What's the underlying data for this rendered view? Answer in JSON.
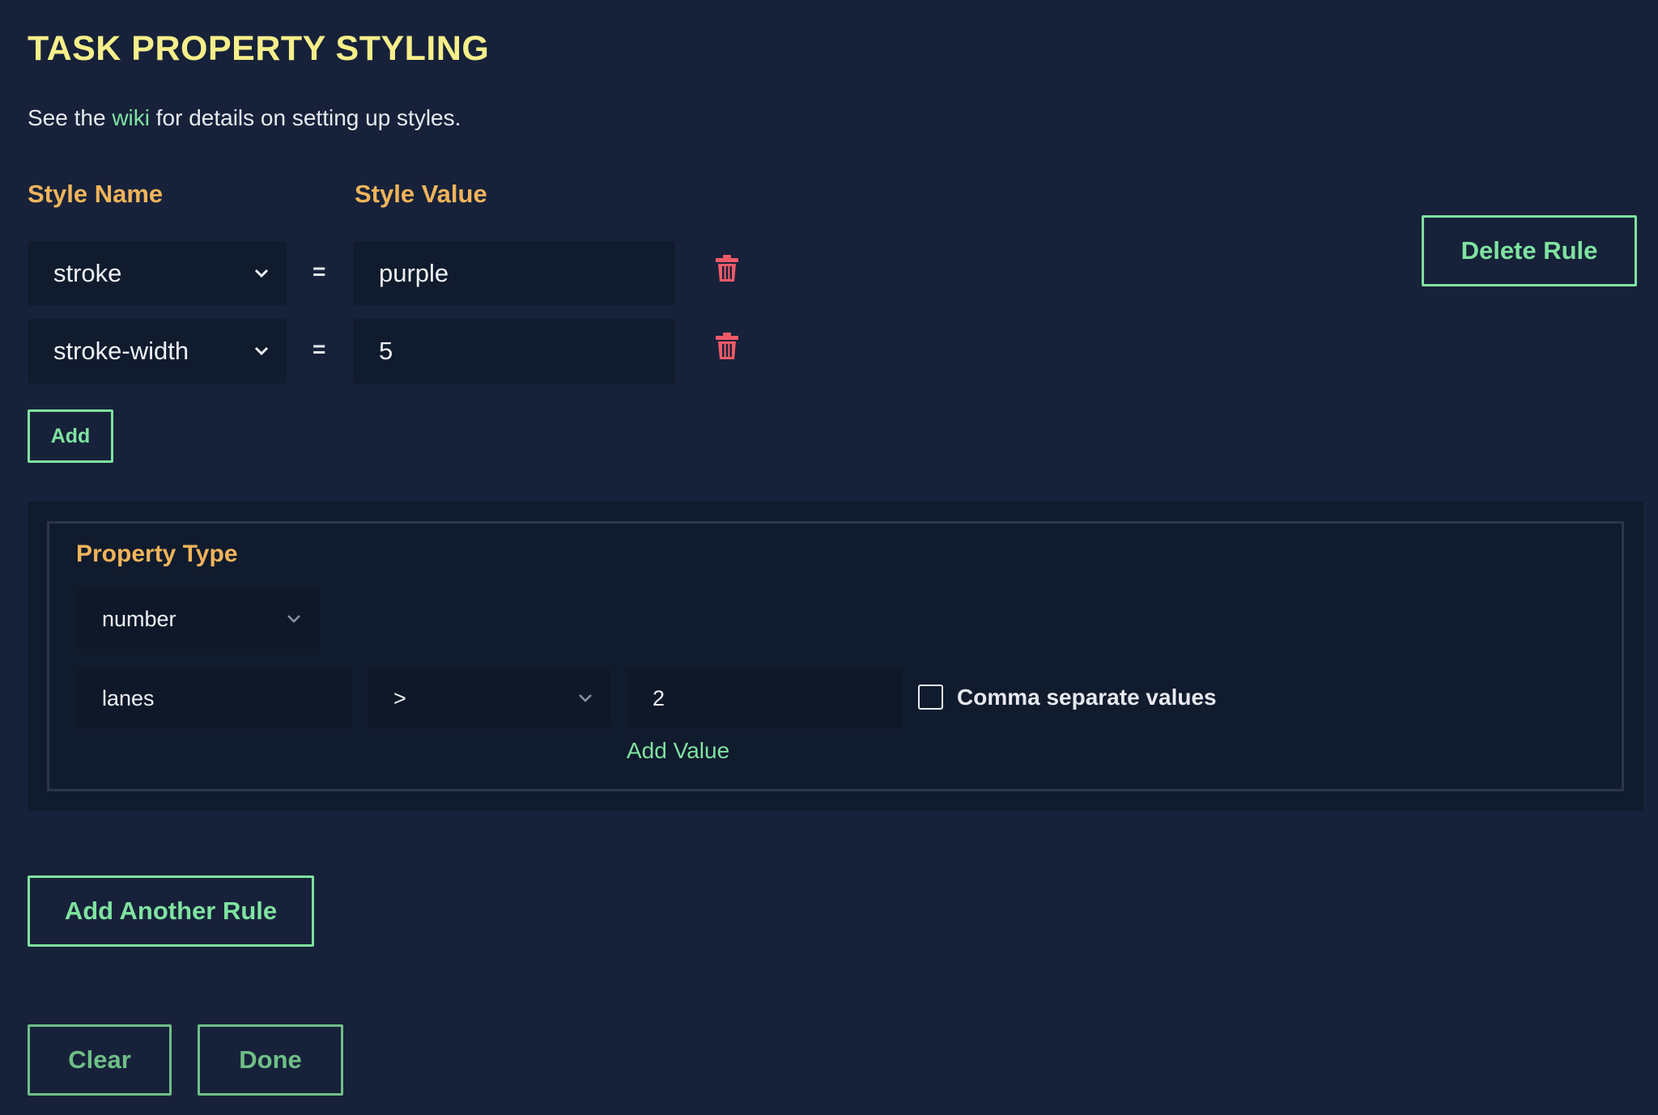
{
  "header": {
    "title": "TASK PROPERTY STYLING",
    "intro_prefix": "See the ",
    "intro_link": "wiki",
    "intro_suffix": " for details on setting up styles."
  },
  "rule": {
    "style_name_label": "Style Name",
    "style_value_label": "Style Value",
    "equals": "=",
    "styles": [
      {
        "name": "stroke",
        "value": "purple"
      },
      {
        "name": "stroke-width",
        "value": "5"
      }
    ],
    "add_label": "Add",
    "delete_rule_label": "Delete Rule",
    "condition": {
      "property_type_label": "Property Type",
      "property_type": "number",
      "property": "lanes",
      "operator": ">",
      "value": "2",
      "comma_separate_label": "Comma separate values",
      "comma_separate_checked": false,
      "add_value_label": "Add Value"
    }
  },
  "footer": {
    "add_another_rule_label": "Add Another Rule",
    "clear_label": "Clear",
    "done_label": "Done"
  },
  "colors": {
    "background": "#17223a",
    "title": "#f6ef8a",
    "label": "#f0b45a",
    "accent": "#7fe3a0",
    "danger": "#f05a68"
  }
}
